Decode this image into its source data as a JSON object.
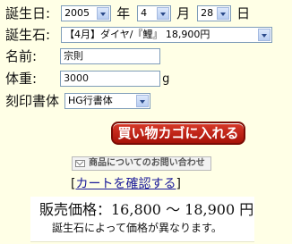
{
  "form": {
    "birthday_label": "誕生日:",
    "year_value": "2005",
    "year_unit": "年",
    "month_value": "4",
    "month_unit": "月",
    "day_value": "28",
    "day_unit": "日",
    "birthstone_label": "誕生石:",
    "birthstone_value": "【4月】ダイヤ/『鯉』 18,900円",
    "name_label": "名前:",
    "name_value": "宗則",
    "weight_label": "体重:",
    "weight_value": "3000",
    "weight_unit": "g",
    "font_label": "刻印書体",
    "font_value": "HG行書体"
  },
  "actions": {
    "buy_label": "買い物カゴに入れる",
    "inquiry_label": "商品についてのお問い合わせ",
    "cart_open": "[",
    "cart_label": "カートを確認する",
    "cart_close": "]"
  },
  "price": {
    "label": "販売価格：16,800 ～ 18,900 円",
    "note": "誕生石によって価格が異なります。"
  },
  "colors": {
    "background": "#ffffe6",
    "buy_button": "#b8180c",
    "link": "#1a1a99"
  },
  "icons": [
    "chevron-down-icon",
    "mail-icon"
  ]
}
